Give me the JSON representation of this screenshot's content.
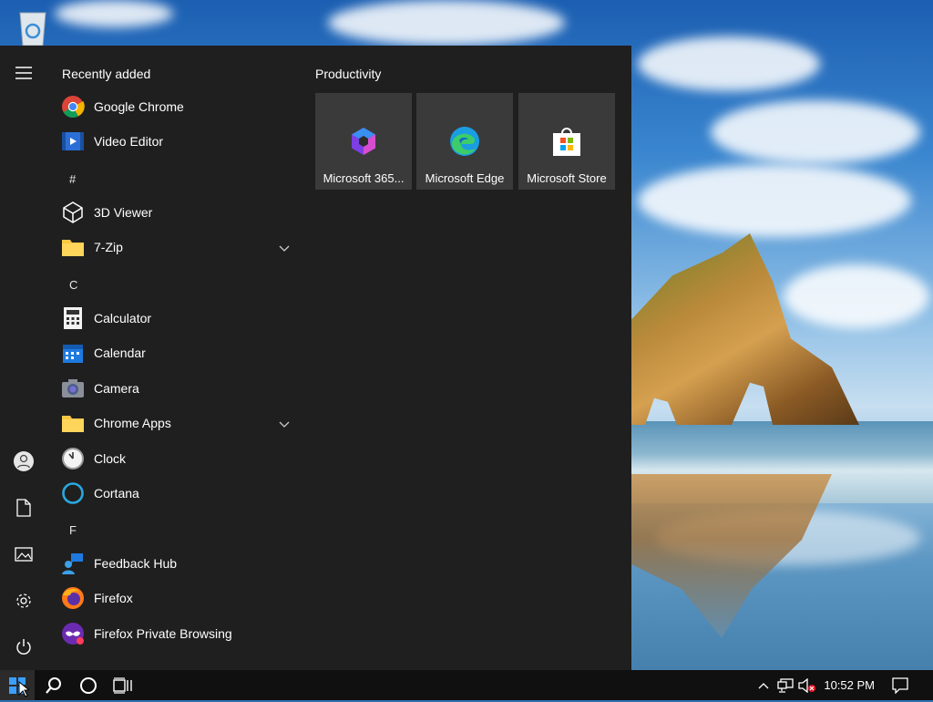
{
  "start_menu": {
    "recently_added_title": "Recently added",
    "groups": [
      {
        "letter": null,
        "apps": [
          {
            "label": "Google Chrome",
            "icon": "chrome-icon"
          },
          {
            "label": "Video Editor",
            "icon": "video-editor-icon"
          }
        ]
      },
      {
        "letter": "#",
        "apps": [
          {
            "label": "3D Viewer",
            "icon": "3d-viewer-icon"
          },
          {
            "label": "7-Zip",
            "icon": "folder-icon",
            "expandable": true
          }
        ]
      },
      {
        "letter": "C",
        "apps": [
          {
            "label": "Calculator",
            "icon": "calculator-icon"
          },
          {
            "label": "Calendar",
            "icon": "calendar-icon"
          },
          {
            "label": "Camera",
            "icon": "camera-icon"
          },
          {
            "label": "Chrome Apps",
            "icon": "folder-icon",
            "expandable": true
          },
          {
            "label": "Clock",
            "icon": "clock-icon"
          },
          {
            "label": "Cortana",
            "icon": "cortana-icon"
          }
        ]
      },
      {
        "letter": "F",
        "apps": [
          {
            "label": "Feedback Hub",
            "icon": "feedback-hub-icon"
          },
          {
            "label": "Firefox",
            "icon": "firefox-icon"
          },
          {
            "label": "Firefox Private Browsing",
            "icon": "firefox-private-icon"
          }
        ]
      }
    ],
    "tiles_group_title": "Productivity",
    "tiles": [
      {
        "label": "Microsoft 365...",
        "icon": "microsoft-365-icon"
      },
      {
        "label": "Microsoft Edge",
        "icon": "edge-icon"
      },
      {
        "label": "Microsoft Store",
        "icon": "store-icon"
      }
    ],
    "rail_icons": [
      "hamburger-menu-icon",
      "user-icon",
      "documents-icon",
      "pictures-icon",
      "settings-icon",
      "power-icon"
    ]
  },
  "taskbar": {
    "time": "10:52 PM",
    "icons": [
      "windows-start-icon",
      "search-icon",
      "cortana-icon",
      "task-view-icon",
      "chevron-up-icon",
      "network-icon",
      "volume-muted-icon",
      "notifications-icon"
    ]
  },
  "colors": {
    "menu_bg": "#1f1f1f",
    "tile_bg": "#3a3a3a",
    "taskbar_bg": "#101010"
  }
}
